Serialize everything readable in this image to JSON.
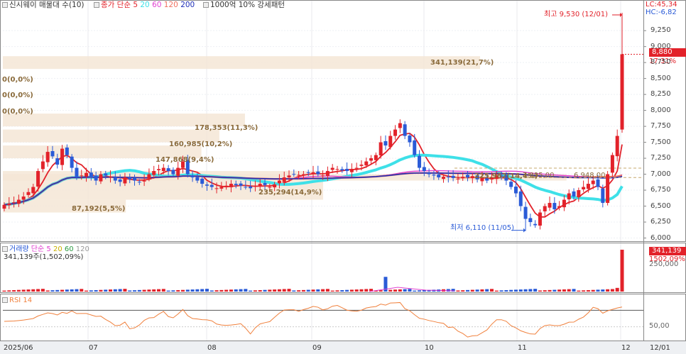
{
  "title_bar": {
    "label": "신시웨이 매물대 수(10)",
    "ma_label": "종가 단순",
    "ma_periods": [
      "5",
      "20",
      "60",
      "120",
      "200"
    ],
    "pattern_label": "1000억 10% 강세패턴"
  },
  "right_header": {
    "lc": "LC:45,34",
    "hc": "HC:-6,82"
  },
  "price_axis": {
    "ticks": [
      "9,250",
      "9,000",
      "8,750",
      "8,500",
      "8,250",
      "8,000",
      "7,750",
      "7,500",
      "7,250",
      "7,000",
      "6,750",
      "6,500",
      "6,250",
      "6,000"
    ],
    "ylim": [
      5950,
      9530
    ]
  },
  "last_price": {
    "value": "8,880",
    "change": "17,31%"
  },
  "annotations": {
    "high": "최고 9,530 (12/01)",
    "low": "최저 6,110 (11/05)",
    "left_zero_1": "0(0,0%)",
    "left_zero_2": "0(0,0%)",
    "left_zero_3": "0(0,0%)"
  },
  "volume_profile": [
    {
      "label": "341,139(21,7%)",
      "price_from": 8650,
      "price_to": 8850,
      "fraction": 0.745
    },
    {
      "label": "178,353(11,3%)",
      "price_from": 7750,
      "price_to": 7950,
      "fraction": 0.378
    },
    {
      "label": "160,985(10,2%)",
      "price_from": 7500,
      "price_to": 7700,
      "fraction": 0.338
    },
    {
      "label": "147,868(9,4%)",
      "price_from": 7250,
      "price_to": 7450,
      "fraction": 0.31
    },
    {
      "label": "235,294(14,9%)",
      "price_from": 6600,
      "price_to": 7050,
      "fraction": 0.5
    },
    {
      "label": "87,192(5,5%)",
      "price_from": 6400,
      "price_to": 6600,
      "fraction": 0.192
    },
    {
      "label": "225,962(14,4%)",
      "price_from": 6900,
      "price_to": 7000,
      "fraction": 0.88
    }
  ],
  "hline_labels": [
    "7,095,00",
    "6,948,00"
  ],
  "volume_panel": {
    "legend_label": "거래량",
    "ma_label": "단순",
    "ma_periods": [
      "5",
      "20",
      "60",
      "120"
    ],
    "current": "341,139주(1,502,09%)",
    "axis_tick": "250,000",
    "tag_value": "341,139",
    "tag_change": "1502,09%"
  },
  "rsi_panel": {
    "label": "RSI 14",
    "axis_tick": "50,00"
  },
  "time_axis": {
    "labels": [
      "2025/06",
      "07",
      "08",
      "09",
      "10",
      "11",
      "12",
      "12/01"
    ]
  },
  "colors": {
    "up": "#e2222a",
    "down": "#2a5bd7",
    "ma5": "#e2222a",
    "ma20": "#3ee0e8",
    "ma60": "#e040d0",
    "ma120": "#f07060",
    "ma200": "#1f2fb8",
    "profile": "#f5e6d6",
    "rsi": "#f0803c"
  },
  "chart_data": {
    "type": "candlestick",
    "title": "신시웨이 매물대 수(10)",
    "ylim": [
      5950,
      9530
    ],
    "high": {
      "date": "12/01",
      "value": 9530
    },
    "low": {
      "date": "11/05",
      "value": 6110
    },
    "close": 8880,
    "month_labels": [
      "2025/06",
      "07",
      "08",
      "09",
      "10",
      "11",
      "12"
    ],
    "closes": [
      6520,
      6540,
      6560,
      6600,
      6650,
      6720,
      6800,
      7050,
      7200,
      7350,
      7280,
      7150,
      7400,
      7300,
      7100,
      6950,
      6980,
      7020,
      6950,
      6900,
      7000,
      6980,
      6960,
      6900,
      6880,
      6950,
      6920,
      6900,
      6880,
      6900,
      7000,
      7050,
      7080,
      7100,
      7050,
      7000,
      7100,
      7200,
      7000,
      6950,
      6900,
      6850,
      6820,
      6800,
      6780,
      6800,
      6820,
      6850,
      6830,
      6820,
      6800,
      6780,
      6820,
      6850,
      6830,
      6800,
      6840,
      6900,
      6950,
      6980,
      7000,
      6990,
      7000,
      7020,
      7030,
      7000,
      6980,
      7050,
      7100,
      7080,
      7060,
      7050,
      7080,
      7100,
      7150,
      7200,
      7250,
      7300,
      7500,
      7450,
      7600,
      7700,
      7800,
      7600,
      7500,
      7300,
      7100,
      7050,
      7000,
      6980,
      6950,
      6960,
      6950,
      6940,
      6930,
      6960,
      6950,
      6970,
      6920,
      6940,
      6900,
      6950,
      6980,
      6960,
      6900,
      6800,
      6700,
      6500,
      6300,
      6250,
      6200,
      6400,
      6500,
      6550,
      6450,
      6500,
      6600,
      6700,
      6650,
      6750,
      6800,
      6850,
      6900,
      6800,
      6550,
      7000,
      7300,
      7600,
      8880
    ],
    "volume_last": 341139,
    "rsi_last": 78
  }
}
